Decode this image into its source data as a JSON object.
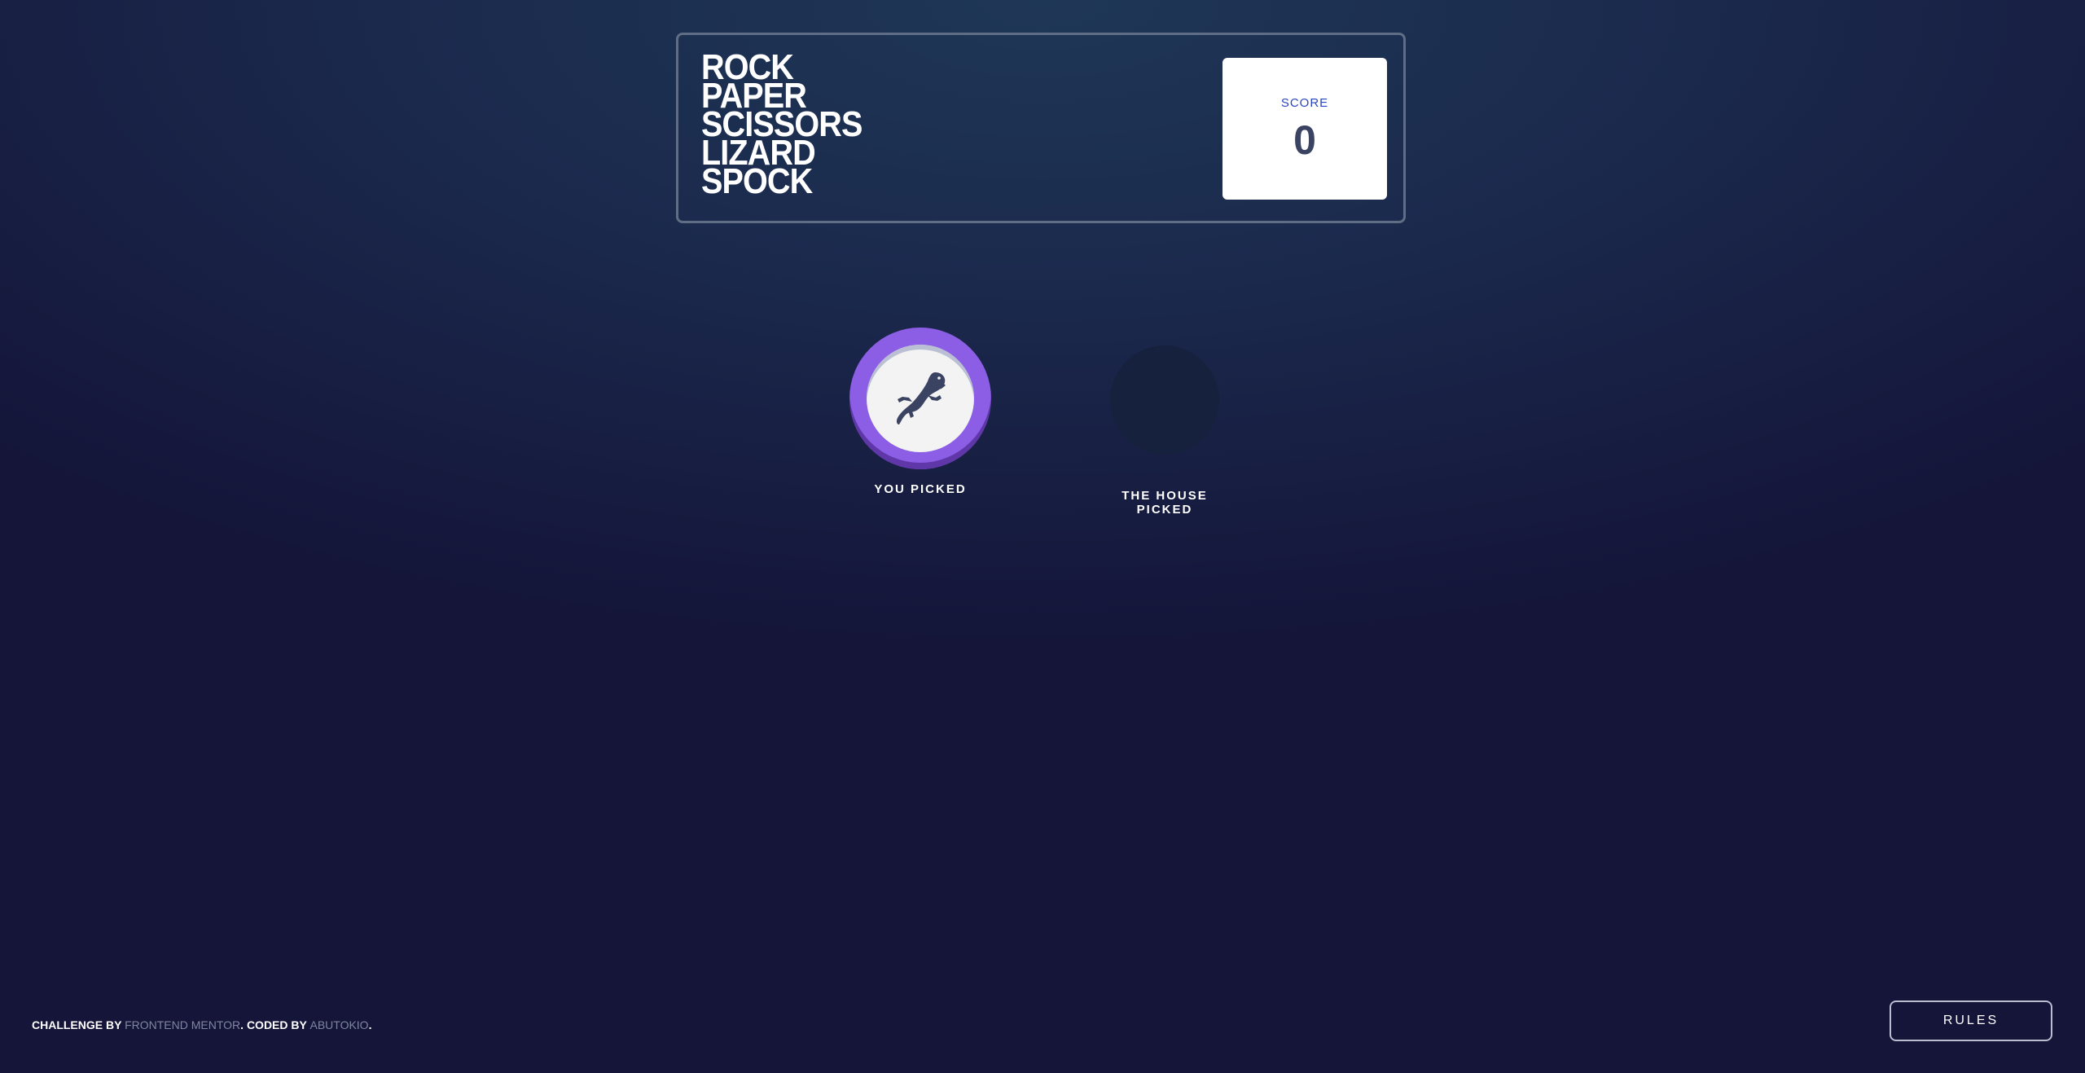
{
  "header": {
    "title_lines": [
      "ROCK",
      "PAPER",
      "SCISSORS",
      "LIZARD",
      "SPOCK"
    ],
    "score_label": "SCORE",
    "score_value": "0"
  },
  "game": {
    "player_pick": {
      "choice_icon": "lizard-icon",
      "label": "YOU PICKED",
      "ring_color": "#8c5de5"
    },
    "house_pick": {
      "label": "THE HOUSE PICKED",
      "state": "empty"
    }
  },
  "footer": {
    "prefix": "CHALLENGE BY ",
    "link1": "FRONTEND MENTOR",
    "middle": ". CODED BY ",
    "link2": "ABUTOKIO",
    "suffix": "."
  },
  "rules_button": {
    "label": "RULES"
  }
}
